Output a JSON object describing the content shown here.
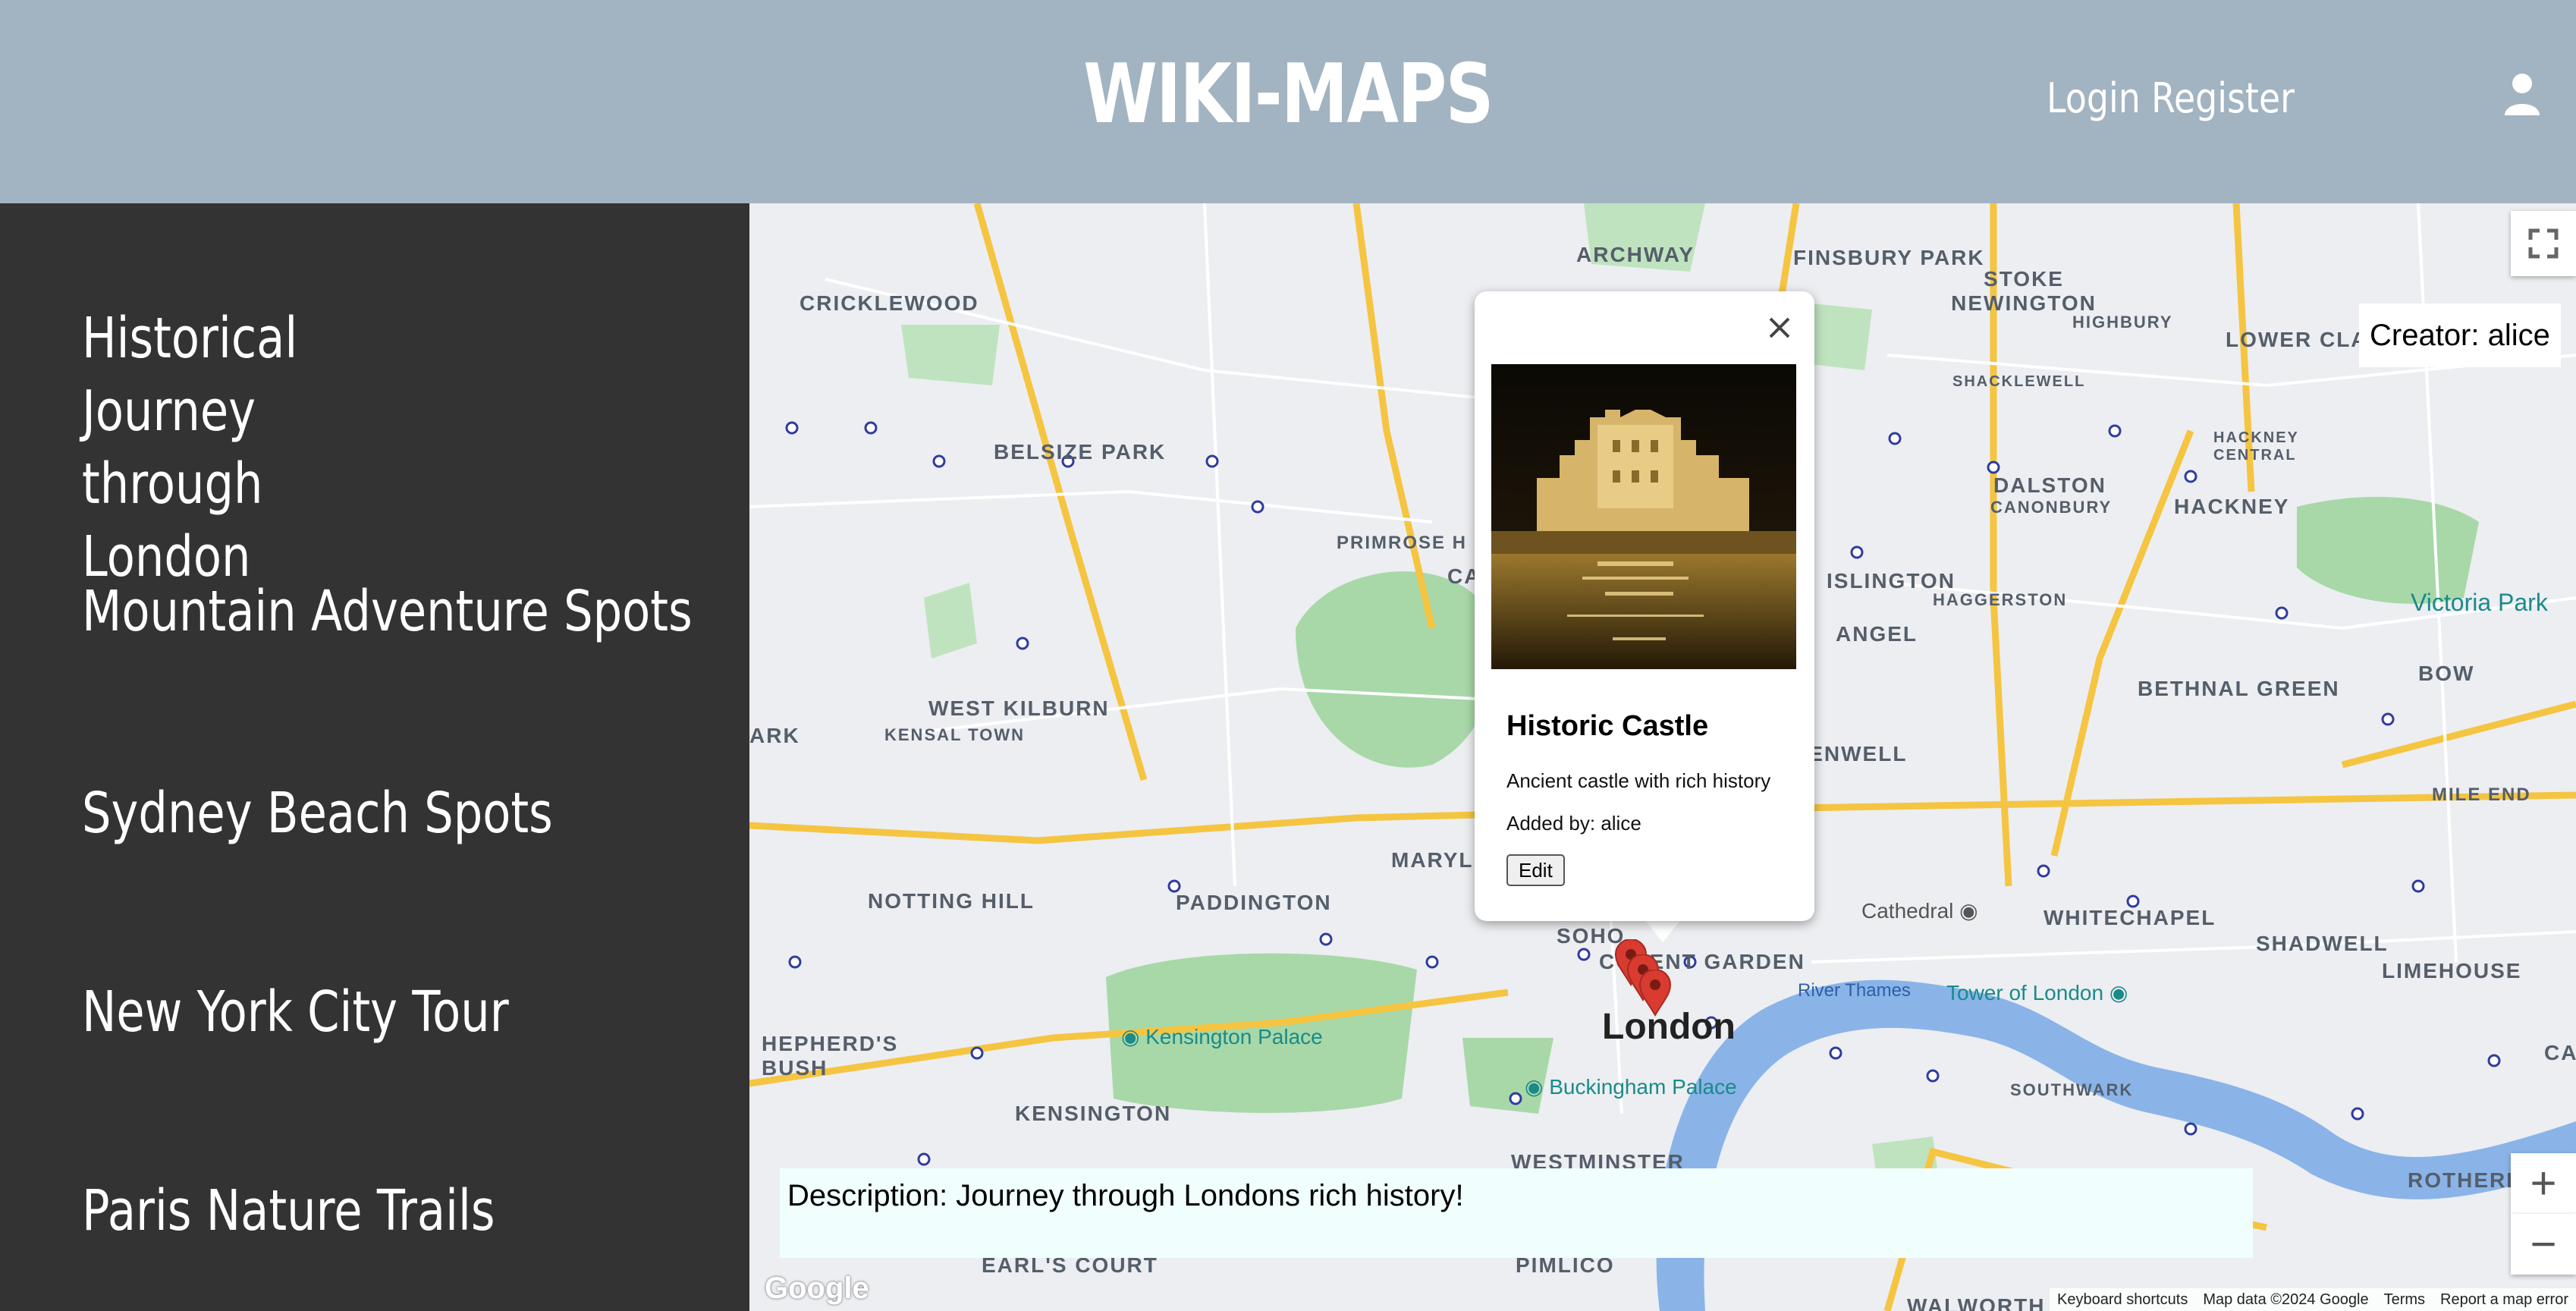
{
  "header": {
    "brand": "WIKI-MAPS",
    "login": "Login",
    "register": "Register"
  },
  "sidebar": {
    "items": [
      {
        "label": "Historical Journey through London"
      },
      {
        "label": "Mountain Adventure Spots"
      },
      {
        "label": "Sydney Beach Spots"
      },
      {
        "label": "New York City Tour"
      },
      {
        "label": "Paris Nature Trails"
      }
    ]
  },
  "map": {
    "creator": "Creator: alice",
    "description": "Description: Journey through Londons rich history!",
    "city_label": "London",
    "places": [
      "CRICKLEWOOD",
      "ARCHWAY",
      "FINSBURY PARK",
      "STOKE NEWINGTON",
      "LOWER CLAPT",
      "HIGHBURY",
      "BELSIZE PARK",
      "PRIMROSE H",
      "DALSTON",
      "HACKNEY",
      "CANONBURY",
      "ISLINGTON",
      "HAGGERSTON",
      "ANGEL",
      "BETHNAL GREEN",
      "BOW",
      "WEST KILBURN",
      "KENSAL TOWN",
      "ARK",
      "KENWELL",
      "MILE END",
      "NOTTING HILL",
      "PADDINGTON",
      "MARYL",
      "SOHO",
      "COVENT GARDEN",
      "WHITECHAPEL",
      "SHADWELL",
      "LIMEHOUSE",
      "HEPHERD'S BUSH",
      "KENSINGTON",
      "SOUTHWARK",
      "ROTHERHITHE",
      "CANAR",
      "WESTMINSTER",
      "EARL'S COURT",
      "PIMLICO",
      "WALWORTH",
      "CA",
      "SHACKLEWELL",
      "HACKNEY CENTRAL"
    ],
    "pois": [
      "Kensington Palace",
      "Buckingham Palace",
      "Tower of London",
      "Victoria Park",
      "Cathedral",
      "River Thames"
    ],
    "google": "Google",
    "attribution": [
      "Keyboard shortcuts",
      "Map data ©2024 Google",
      "Terms",
      "Report a map error"
    ]
  },
  "info_window": {
    "title": "Historic Castle",
    "description": "Ancient castle with rich history",
    "added_by": "Added by: alice",
    "edit_label": "Edit"
  }
}
